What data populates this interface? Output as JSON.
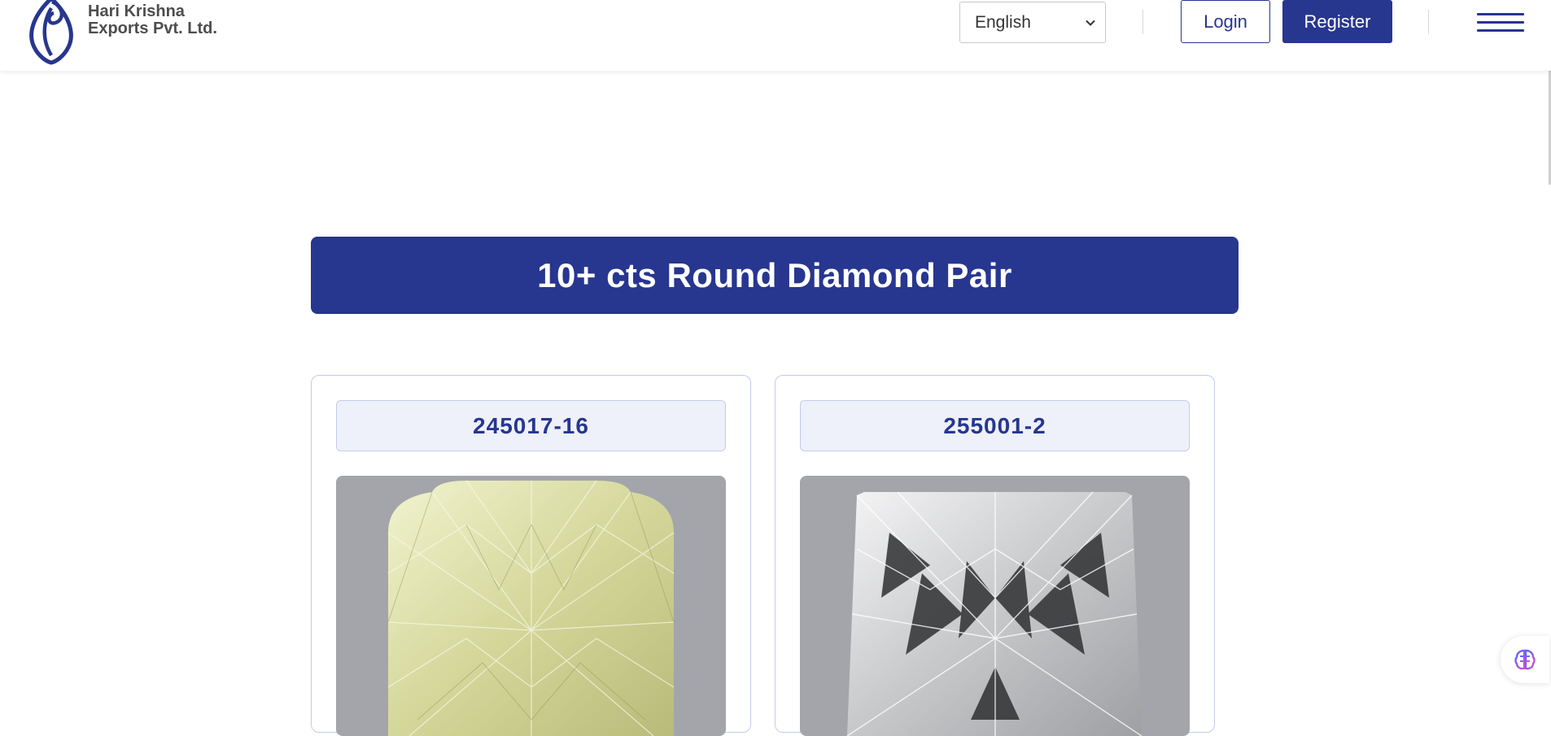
{
  "header": {
    "brand_line1": "Hari Krishna",
    "brand_line2": "Exports Pvt. Ltd.",
    "language": {
      "selected": "English",
      "icon": "chevron-down-icon"
    },
    "login_label": "Login",
    "register_label": "Register",
    "menu_icon": "hamburger-menu-icon"
  },
  "main": {
    "title": "10+ cts Round Diamond Pair",
    "cards": [
      {
        "id": "245017-16",
        "image": "yellow cushion-cut diamond"
      },
      {
        "id": "255001-2",
        "image": "white princess-cut diamond"
      }
    ]
  },
  "widget": {
    "icon": "brain-icon"
  },
  "colors": {
    "brand": "#27368f",
    "card_border": "#c5cbe8",
    "id_background": "#eef1fa",
    "image_background": "#a3a5aa"
  }
}
